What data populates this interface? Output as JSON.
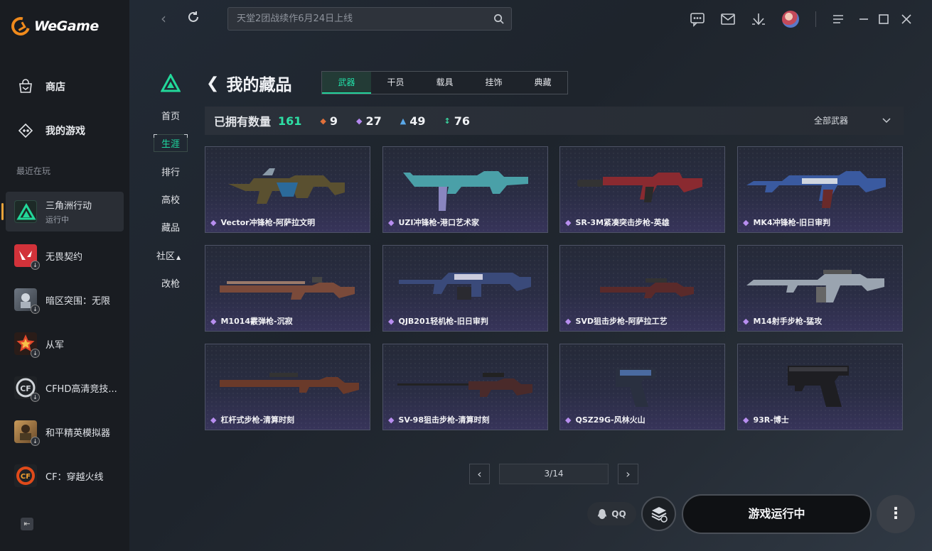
{
  "app": {
    "name": "WeGame"
  },
  "sidebar": {
    "nav": [
      {
        "label": "商店",
        "icon": "store-icon"
      },
      {
        "label": "我的游戏",
        "icon": "gamepad-icon"
      }
    ],
    "recent_label": "最近在玩",
    "games": [
      {
        "name": "三角洲行动",
        "status": "运行中"
      },
      {
        "name": "无畏契约"
      },
      {
        "name": "暗区突围：无限"
      },
      {
        "name": "从军"
      },
      {
        "name": "CFHD高清竞技..."
      },
      {
        "name": "和平精英模拟器"
      },
      {
        "name": "CF：穿越火线"
      }
    ]
  },
  "topbar": {
    "search_placeholder": "天堂2团战续作6月24日上线"
  },
  "inner_nav": [
    "首页",
    "生涯",
    "排行",
    "高校",
    "藏品",
    "社区",
    "改枪"
  ],
  "inner_nav_active": "生涯",
  "page": {
    "title": "我的藏品",
    "tabs": [
      "武器",
      "干员",
      "载具",
      "挂饰",
      "典藏"
    ],
    "active_tab": "武器"
  },
  "stats": {
    "label": "已拥有数量",
    "total": "161",
    "counts": [
      {
        "value": "9",
        "color": "#e0703a"
      },
      {
        "value": "27",
        "color": "#b488f0"
      },
      {
        "value": "49",
        "color": "#5aa8e8"
      },
      {
        "value": "76",
        "color": "#3ad6a0"
      }
    ],
    "filter": "全部武器"
  },
  "items": [
    {
      "name": "Vector冲锋枪-阿萨拉文明"
    },
    {
      "name": "UZI冲锋枪-港口艺术家"
    },
    {
      "name": "SR-3M紧凑突击步枪-英雄"
    },
    {
      "name": "MK4冲锋枪-旧日审判"
    },
    {
      "name": "M1014霰弹枪-沉寂"
    },
    {
      "name": "QJB201轻机枪-旧日审判"
    },
    {
      "name": "SVD狙击步枪-阿萨拉工艺"
    },
    {
      "name": "M14射手步枪-猛攻"
    },
    {
      "name": "杠杆式步枪-清算时刻"
    },
    {
      "name": "SV-98狙击步枪-清算时刻"
    },
    {
      "name": "QSZ29G-风林火山"
    },
    {
      "name": "93R-博士"
    }
  ],
  "pagination": {
    "text": "3/14"
  },
  "bottom": {
    "qq_label": "QQ",
    "run_label": "游戏运行中",
    "more_label": "⋮"
  }
}
